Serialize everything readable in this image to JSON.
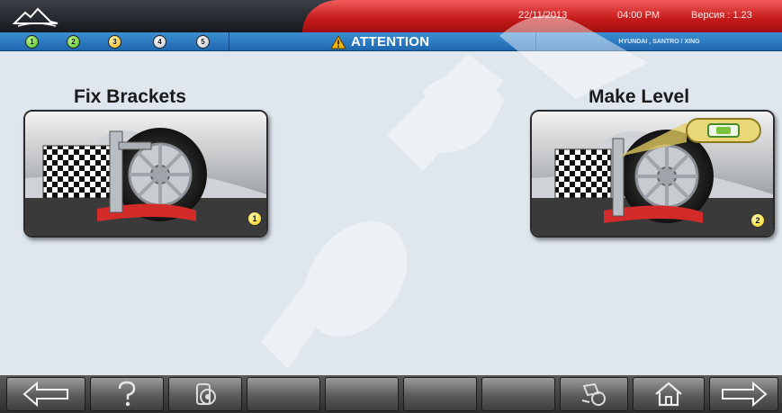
{
  "header": {
    "date": "22/11/2013",
    "time": "04:00 PM",
    "version": "Версия : 1.23"
  },
  "steps": [
    "1",
    "2",
    "3",
    "4",
    "5"
  ],
  "attention": {
    "label": "ATTENTION"
  },
  "vehicle": "HYUNDAI , SANTRO / XING",
  "panels": [
    {
      "title": "Fix Brackets",
      "badge": "1"
    },
    {
      "title": "Make Level",
      "badge": "2"
    }
  ],
  "toolbar": {
    "back_icon": "arrow-left-icon",
    "help_icon": "question-icon",
    "settings_icon": "wheel-clamp-icon",
    "tools_icon": "clamp-tool-icon",
    "home_icon": "home-icon",
    "next_icon": "arrow-right-icon"
  },
  "colors": {
    "accent_red": "#c41a1a",
    "status_blue": "#2a78c2",
    "step_done": "#3fbd18",
    "step_current": "#f1b316",
    "badge_yellow": "#f6d000"
  }
}
